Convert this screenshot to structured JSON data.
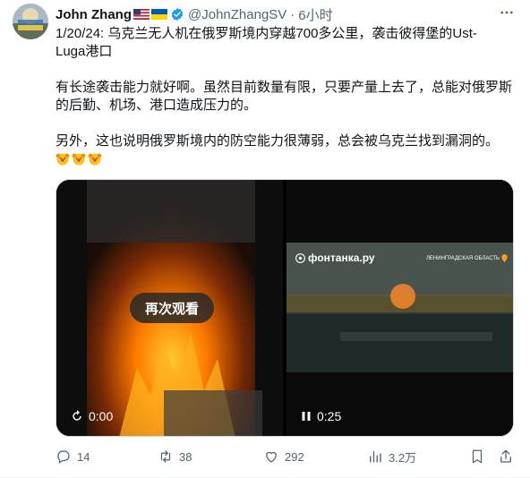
{
  "author": {
    "display_name": "John Zhang",
    "handle": "@JohnZhangSV",
    "separator": "·",
    "time": "6小时"
  },
  "tweet": {
    "line1": "1/20/24: 乌克兰无人机在俄罗斯境内穿越700多公里，袭击彼得堡的Ust-",
    "line2": "Luga港口",
    "para2_line1": "有长途袭击能力就好啊。虽然目前数量有限，只要产量上去了，总能对俄罗斯",
    "para2_line2": "的后勤、机场、港口造成压力的。",
    "para3": "另外，这也说明俄罗斯境内的防空能力很薄弱，总会被乌克兰找到漏洞的。"
  },
  "media": {
    "video1": {
      "replay_label": "再次观看",
      "time": "0:00"
    },
    "video2": {
      "watermark": "фонтанка.ру",
      "region_label": "ЛЕНИНГРАДСКАЯ ОБЛАСТЬ",
      "time": "0:25"
    }
  },
  "actions": {
    "replies": "14",
    "retweets": "38",
    "likes": "292",
    "views": "3.2万"
  },
  "icons": [
    "more-icon",
    "verified-icon",
    "us-flag-icon",
    "ukraine-flag-icon",
    "clown-emoji-icon",
    "reply-icon",
    "retweet-icon",
    "like-icon",
    "views-icon",
    "bookmark-icon",
    "share-icon",
    "play-icon",
    "pause-icon",
    "location-pin-icon"
  ],
  "colors": {
    "verified_blue": "#1d9bf0",
    "muted": "#536471",
    "text": "#0f1419"
  }
}
